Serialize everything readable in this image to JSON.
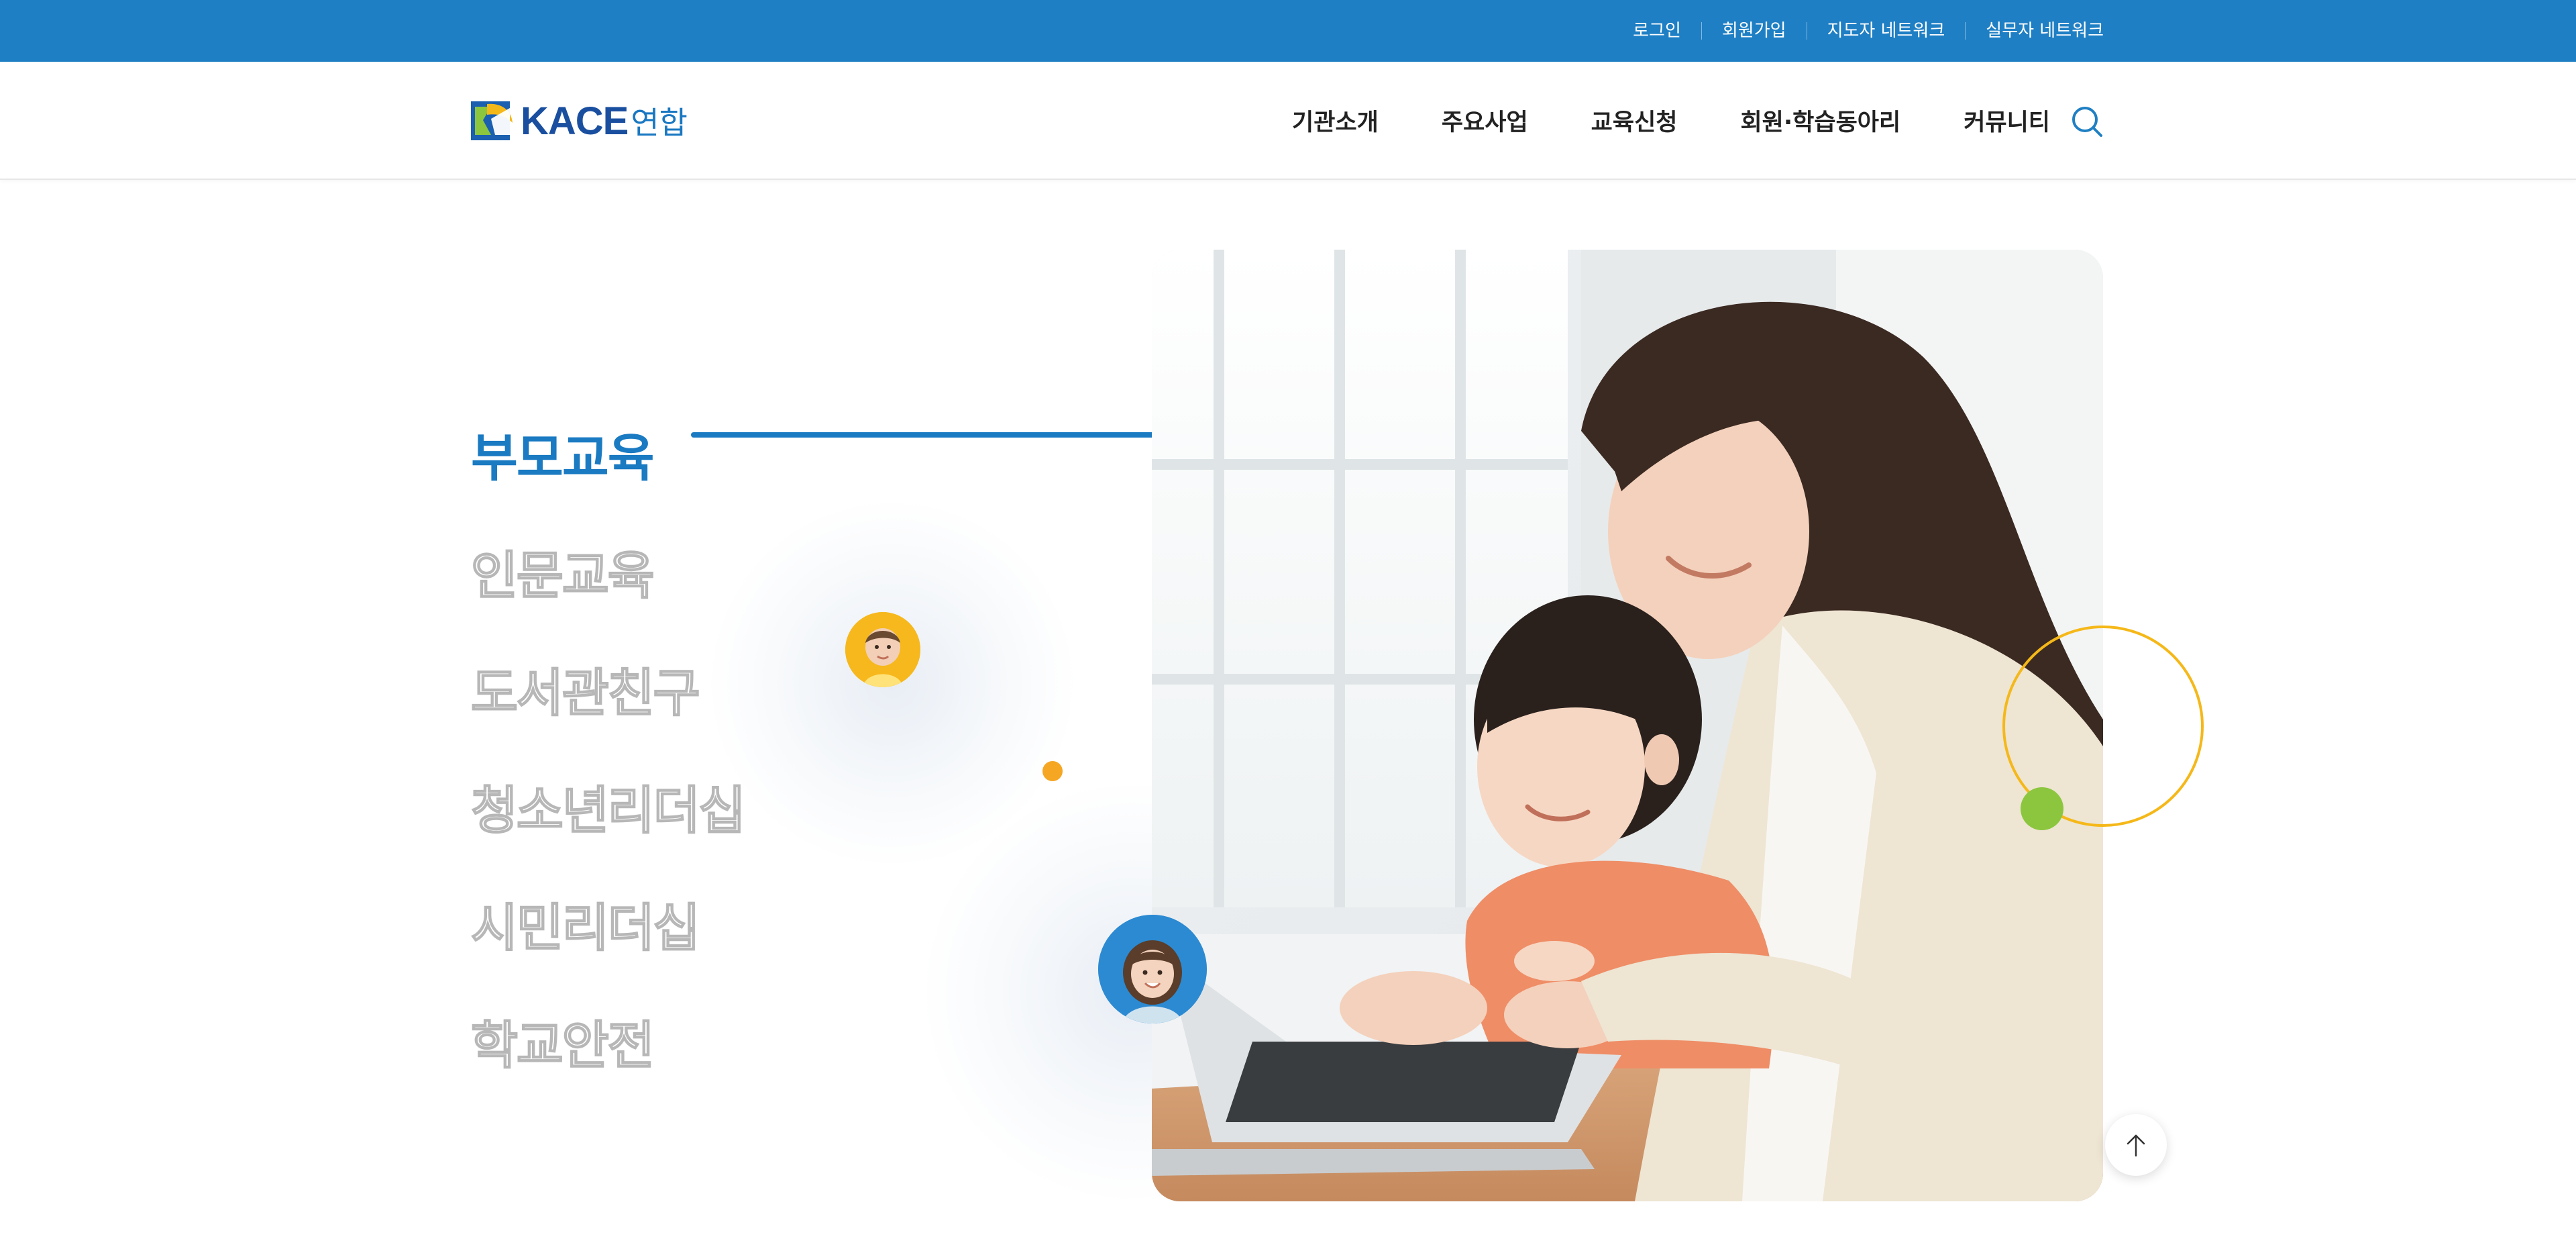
{
  "util_nav": {
    "login": "로그인",
    "signup": "회원가입",
    "mentor_network": "지도자 네트워크",
    "staff_network": "실무자 네트워크"
  },
  "brand": {
    "logo_latin": "KACE",
    "logo_korean": "연합",
    "colors": {
      "primary": "#1f7fc4",
      "accent_yellow": "#f5b819",
      "accent_green": "#8cc63f",
      "accent_orange": "#f5a623"
    }
  },
  "gnb": {
    "items": [
      "기관소개",
      "주요사업",
      "교육신청",
      "회원·학습동아리",
      "커뮤니티"
    ],
    "search_icon": "search-icon"
  },
  "programs": {
    "active_index": 0,
    "items": [
      "부모교육",
      "인문교육",
      "도서관친구",
      "청소년리더십",
      "시민리더십",
      "학교안전"
    ]
  },
  "scroll_top_icon": "arrow-up-icon"
}
